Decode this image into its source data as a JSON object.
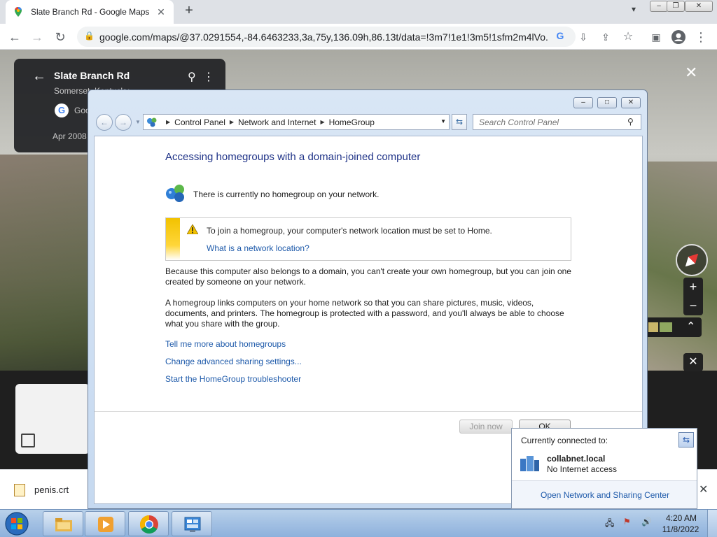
{
  "browser": {
    "tab_title": "Slate Branch Rd - Google Maps",
    "tab_close": "✕",
    "new_tab": "+",
    "url": "google.com/maps/@37.0291554,-84.6463233,3a,75y,136.09h,86.13t/data=!3m7!1e1!3m5!1sfm2m4lVo..."
  },
  "maps": {
    "place_name": "Slate Branch Rd",
    "place_sub": "Somerset, Kentucky",
    "provider": "Google",
    "date": "Apr 2008",
    "close": "✕",
    "zoom_in": "+",
    "zoom_out": "−"
  },
  "download": {
    "filename": "penis.crt",
    "close": "✕"
  },
  "control_panel": {
    "breadcrumb": [
      "Control Panel",
      "Network and Internet",
      "HomeGroup"
    ],
    "search_placeholder": "Search Control Panel",
    "heading": "Accessing homegroups with a domain-joined computer",
    "no_homegroup": "There is currently no homegroup on your network.",
    "warning_text": "To join a homegroup, your computer's network location must be set to Home.",
    "warning_link": "What is a network location?",
    "para1_line1": "Because this computer also belongs to a domain, you can't create your own homegroup, but you can join one",
    "para1_line2": "created by someone on your network.",
    "para2_line1": "A homegroup links computers on your home network so that you can share pictures, music, videos,",
    "para2_line2": "documents, and printers. The homegroup is protected with a password, and you'll always be able to choose",
    "para2_line3": "what you share with the group.",
    "link1": "Tell me more about homegroups",
    "link2": "Change advanced sharing settings...",
    "link3": "Start the HomeGroup troubleshooter",
    "join_button": "Join now",
    "ok_button": "OK"
  },
  "network_flyout": {
    "header": "Currently connected to:",
    "domain": "collabnet.local",
    "status": "No Internet access",
    "footer_link": "Open Network and Sharing Center"
  },
  "taskbar": {
    "time": "4:20 AM",
    "date": "11/8/2022"
  }
}
